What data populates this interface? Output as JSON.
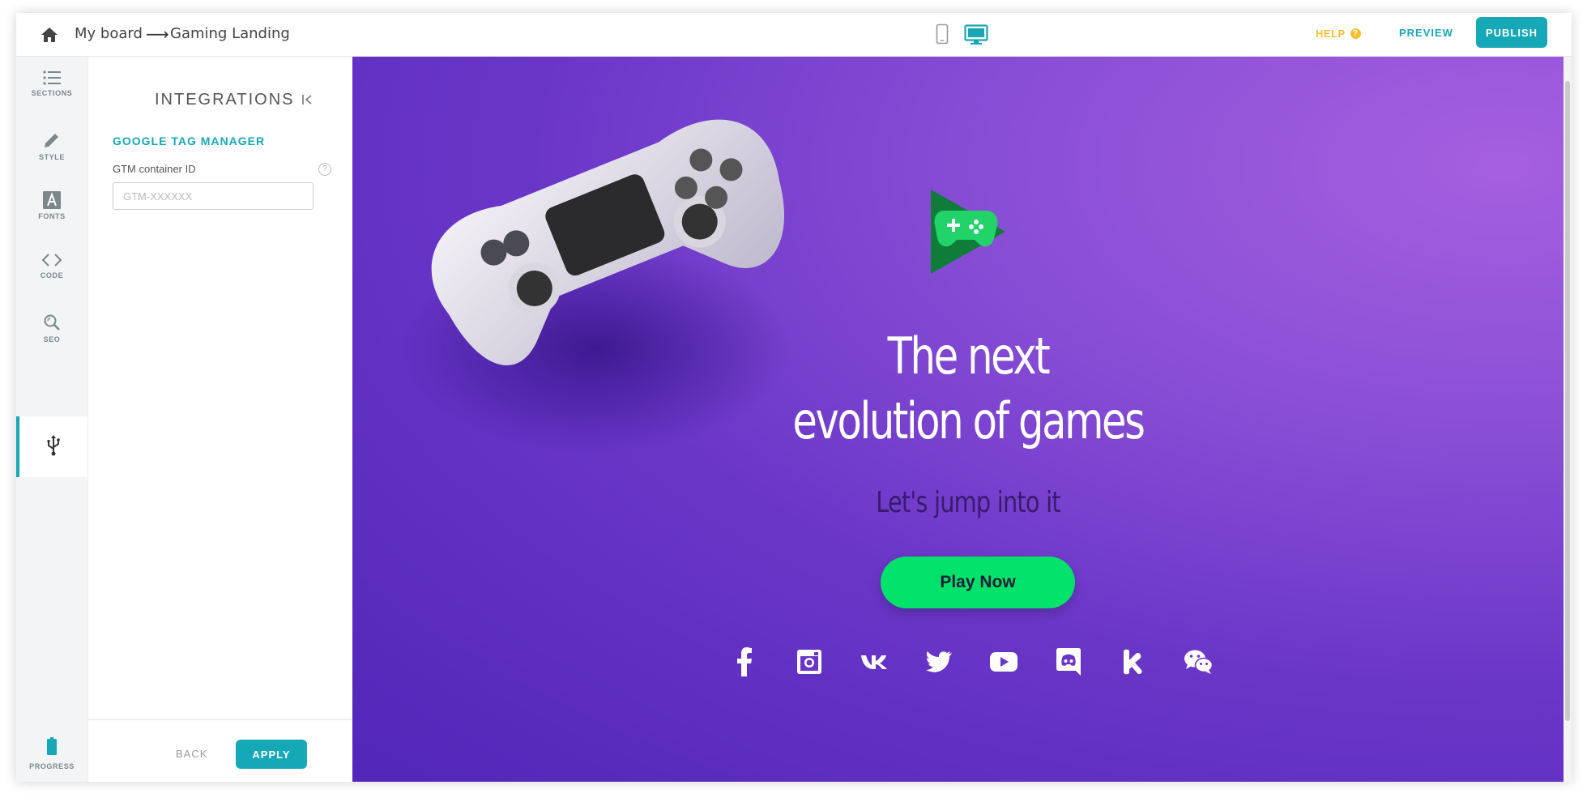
{
  "topbar": {
    "breadcrumb_board": "My board",
    "breadcrumb_arrow": "⟶",
    "breadcrumb_page": "Gaming Landing",
    "help_label": "HELP",
    "help_badge": "?",
    "preview_label": "PREVIEW",
    "publish_label": "PUBLISH"
  },
  "rail": {
    "items": [
      {
        "label": "SECTIONS",
        "icon": "list-icon"
      },
      {
        "label": "STYLE",
        "icon": "pencil-icon"
      },
      {
        "label": "FONTS",
        "icon": "font-icon"
      },
      {
        "label": "CODE",
        "icon": "code-icon"
      },
      {
        "label": "SEO",
        "icon": "seo-search-icon"
      }
    ],
    "active_icon": "usb-integrations-icon",
    "progress_label": "PROGRESS"
  },
  "panel": {
    "title": "INTEGRATIONS",
    "section_title": "GOOGLE TAG MANAGER",
    "field_label": "GTM container ID",
    "field_help": "?",
    "field_placeholder": "GTM-XXXXXX",
    "field_value": "",
    "back_label": "BACK",
    "apply_label": "APPLY"
  },
  "canvas": {
    "headline_line1": "The next",
    "headline_line2": "evolution of games",
    "subline": "Let's jump into it",
    "cta_label": "Play Now",
    "socials": [
      "facebook-icon",
      "instagram-icon",
      "vk-icon",
      "twitter-icon",
      "youtube-icon",
      "discord-icon",
      "kik-icon",
      "wechat-icon"
    ]
  },
  "colors": {
    "accent": "#17a8b8",
    "help": "#f3c130",
    "cta": "#00e26a",
    "canvas_bg": "#6a36c8"
  }
}
